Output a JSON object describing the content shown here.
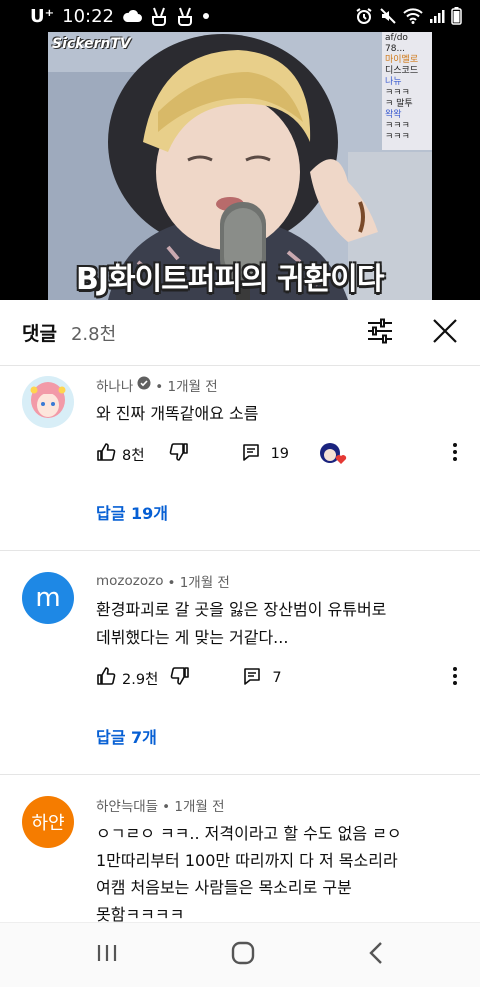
{
  "status_bar": {
    "carrier": "U⁺",
    "time": "10:22"
  },
  "video": {
    "watermark": "SickernTV",
    "caption": "BJ화이트퍼피의 귀환이다",
    "chat_lines": [
      "af/do",
      "78...",
      "마이멜로",
      "디스코드",
      "나뉴",
      "ㅋㅋㅋ",
      "ㅋ 말투",
      "왁왁",
      "ㅋㅋㅋ",
      "ㅋㅋㅋ"
    ],
    "progress_fraction": 0.2
  },
  "comments_header": {
    "title": "댓글",
    "count": "2.8천"
  },
  "comments": [
    {
      "author": "하나나",
      "time": "• 1개월 전",
      "text": "와 진짜 개똑같애요 소름",
      "likes": "8천",
      "replies_count": "19",
      "reply_link": "답글 19개"
    },
    {
      "author": "mozozozo",
      "time": "• 1개월 전",
      "avatar_letter": "m",
      "text_lines": [
        "환경파괴로 갈 곳을 잃은 장산범이 유튜버로",
        "데뷔했다는 게 맞는 거같다..."
      ],
      "likes": "2.9천",
      "replies_count": "7",
      "reply_link": "답글 7개"
    },
    {
      "author": "하얀늑대들",
      "time": "• 1개월 전",
      "avatar_letter": "하얀",
      "text_lines": [
        "ㅇㄱㄹㅇ ㅋㅋ.. 저격이라고 할 수도 없음 ㄹㅇ",
        "1만따리부터 100만 따리까지 다 저 목소리라",
        "여캠 처음보는 사람들은 목소리로 구분",
        "못함ㅋㅋㅋㅋ"
      ]
    }
  ],
  "colors": {
    "link_blue": "#065fd4",
    "avatar_m_blue": "#1e88e5",
    "avatar_orange": "#f57c00",
    "progress_red": "#ff0000"
  },
  "icons": [
    "cloud-icon",
    "peace-hand-icon",
    "alarm-icon",
    "mute-icon",
    "wifi-icon",
    "signal-icon",
    "battery-icon",
    "filter-icon",
    "close-icon",
    "thumb-up-icon",
    "thumb-down-icon",
    "reply-icon",
    "verified-icon",
    "more-vert-icon",
    "recent-apps-icon",
    "home-icon",
    "back-icon"
  ]
}
